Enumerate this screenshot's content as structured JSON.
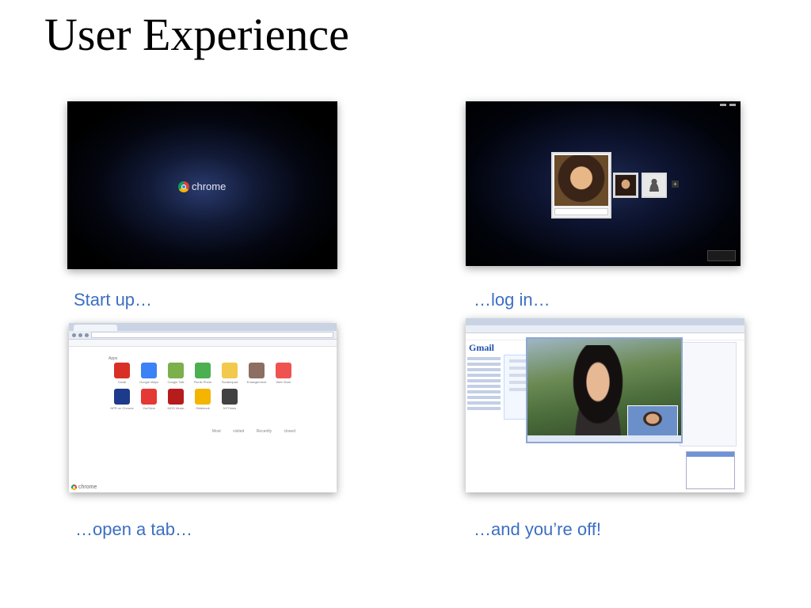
{
  "slide": {
    "title": "User Experience"
  },
  "panels": [
    {
      "caption": "Start up…"
    },
    {
      "caption": "…log in…"
    },
    {
      "caption": "…open a tab…"
    },
    {
      "caption": "…and you’re off!"
    }
  ],
  "startup_screen": {
    "brand": "chrome"
  },
  "login_screen": {
    "add_label": "+"
  },
  "newtab_screen": {
    "apps_heading": "Apps",
    "apps": [
      {
        "name": "Gmail",
        "icon": "gmail-icon",
        "color": "#d93025"
      },
      {
        "name": "Google Maps",
        "icon": "maps-icon",
        "color": "#3b82f6"
      },
      {
        "name": "Google Talk",
        "icon": "talk-icon",
        "color": "#7bb04b"
      },
      {
        "name": "Picnik Photo",
        "icon": "photo-icon",
        "color": "#4caf50"
      },
      {
        "name": "Scratchpad",
        "icon": "notepad-icon",
        "color": "#f2c94c"
      },
      {
        "name": "Entanglement",
        "icon": "entanglement-icon",
        "color": "#8d6e63"
      },
      {
        "name": "Web Store",
        "icon": "store-icon",
        "color": "#ef5350"
      },
      {
        "name": "NPR on Chrome",
        "icon": "npr-icon",
        "color": "#1e3a8a"
      },
      {
        "name": "YouTube",
        "icon": "youtube-icon",
        "color": "#e53935"
      },
      {
        "name": "MOG Music",
        "icon": "music-icon",
        "color": "#b71c1c"
      },
      {
        "name": "Slidebook",
        "icon": "slides-icon",
        "color": "#f4b400"
      },
      {
        "name": "NYTimes",
        "icon": "nytimes-icon",
        "color": "#424242"
      }
    ],
    "footer_links": "Most visited   Recently closed",
    "brand": "chrome"
  },
  "gmail_screen": {
    "logo": "Gmail"
  }
}
